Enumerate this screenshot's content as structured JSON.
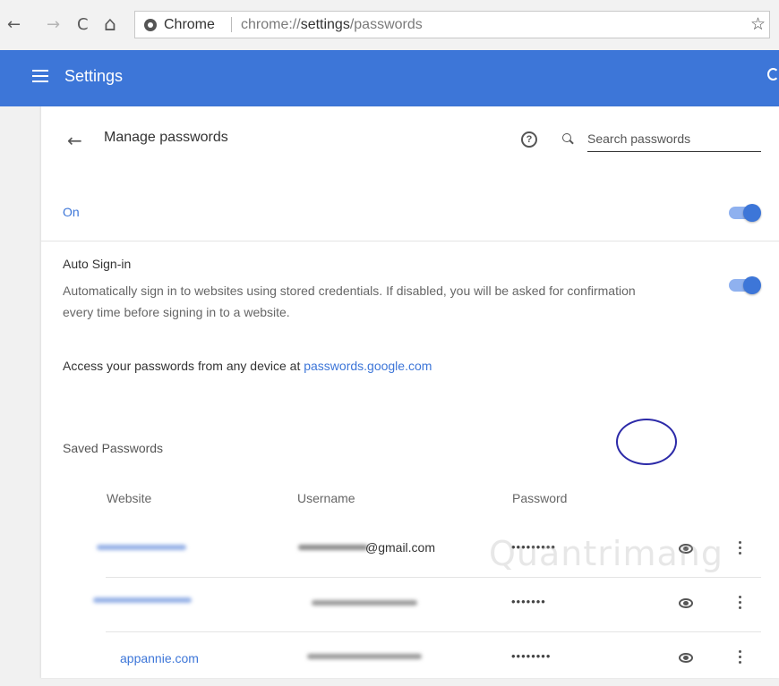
{
  "browser": {
    "back_glyph": "←",
    "forward_glyph": "→",
    "reload_glyph": "C",
    "home_glyph": "⌂",
    "chip_label": "Chrome",
    "url_scheme": "chrome://",
    "url_host": "settings",
    "url_path": "/passwords",
    "star_glyph": "☆"
  },
  "appbar": {
    "title": "Settings",
    "color": "#3d76d8"
  },
  "header": {
    "back_glyph": "←",
    "title": "Manage passwords",
    "help_glyph": "?",
    "search_placeholder": "Search passwords"
  },
  "settings": {
    "on_label": "On",
    "on_enabled": true,
    "autosignin_title": "Auto Sign-in",
    "autosignin_desc": "Automatically sign in to websites using stored credentials. If disabled, you will be asked for confirmation every time before signing in to a website.",
    "autosignin_enabled": true,
    "access_text": "Access your passwords from any device at ",
    "access_link": "passwords.google.com"
  },
  "saved": {
    "heading": "Saved Passwords",
    "columns": {
      "website": "Website",
      "username": "Username",
      "password": "Password"
    },
    "rows": [
      {
        "website": "",
        "username": "@gmail.com",
        "password": "•••••••••"
      },
      {
        "website": "",
        "username": "",
        "password": "•••••••"
      },
      {
        "website": "appannie.com",
        "username": "",
        "password": "••••••••"
      }
    ]
  },
  "watermark": "Quantrimang",
  "icons": [
    "back-icon",
    "forward-icon",
    "reload-icon",
    "home-icon",
    "chrome-icon",
    "star-icon",
    "menu-icon",
    "search-icon",
    "help-icon",
    "eye-icon",
    "more-icon"
  ]
}
